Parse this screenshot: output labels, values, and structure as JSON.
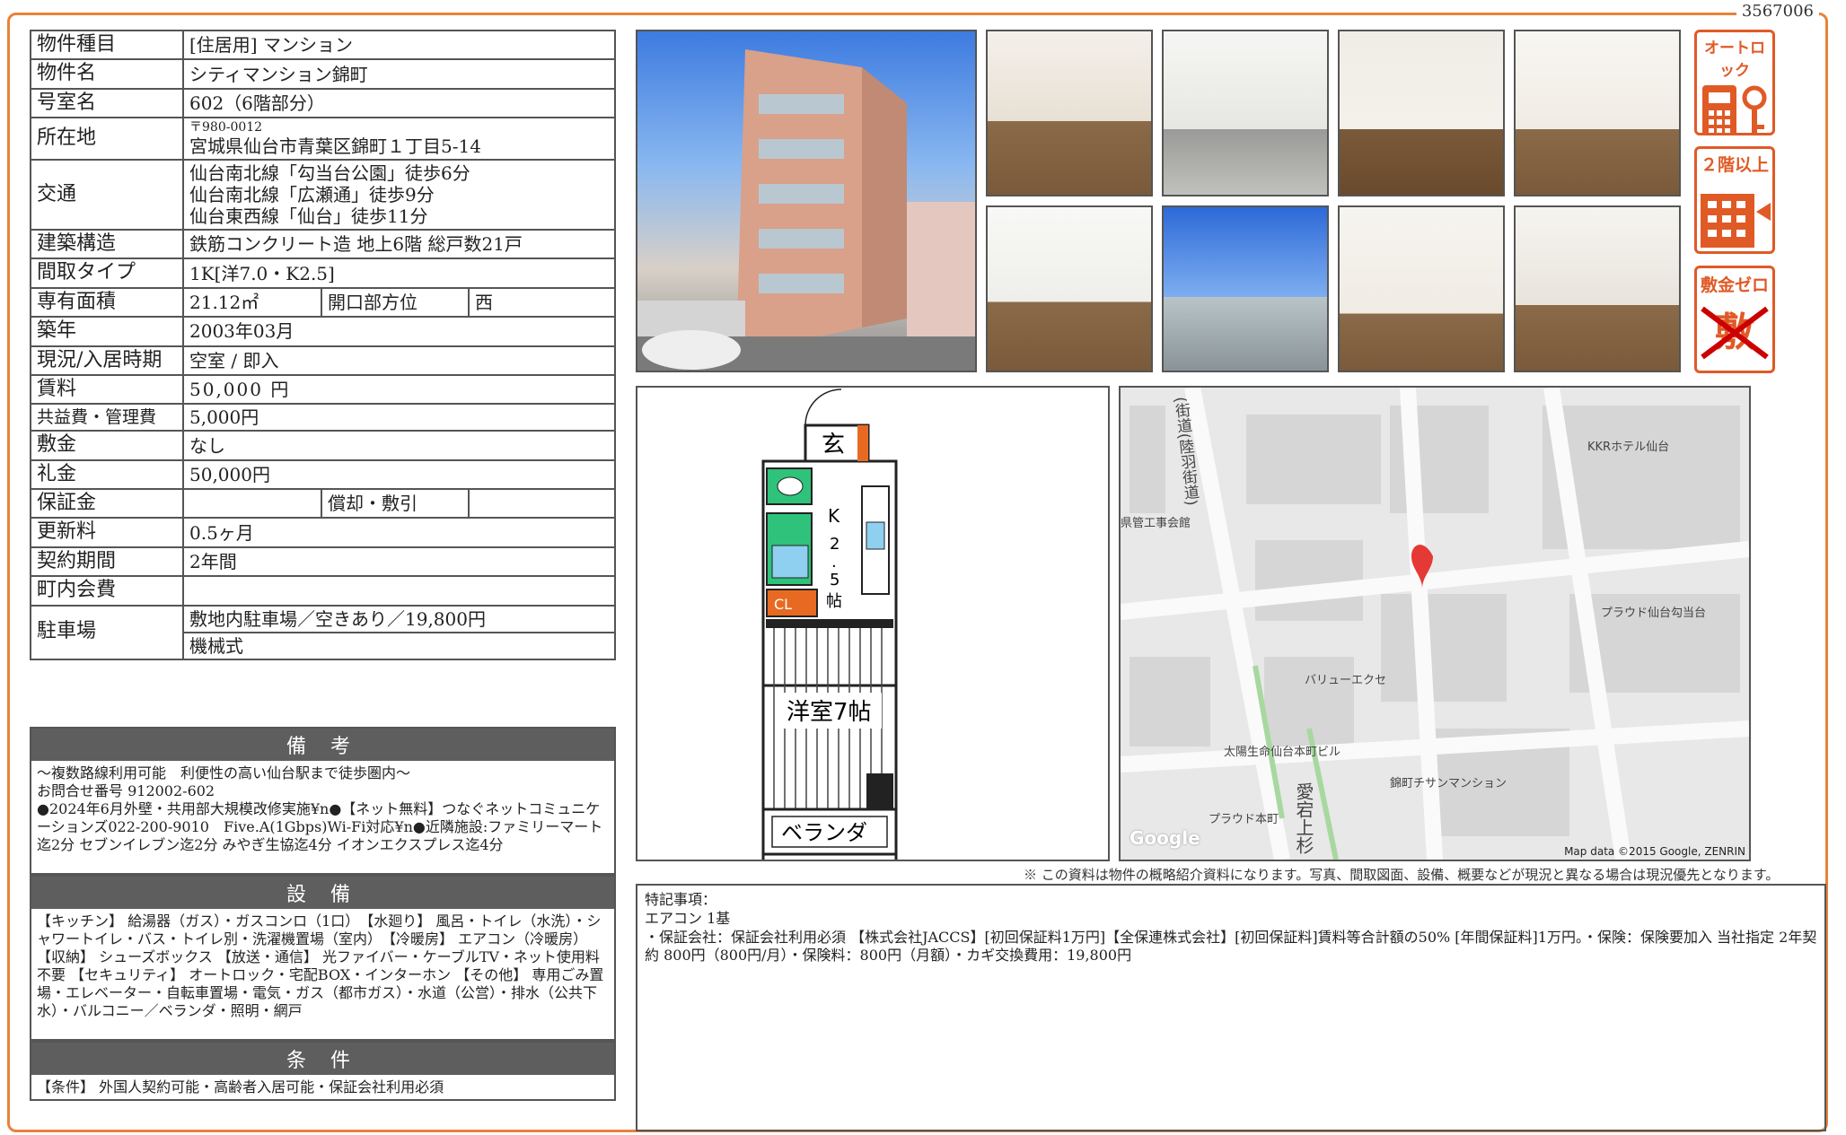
{
  "doc_id": "3567006",
  "spec": {
    "type_label": "物件種目",
    "type_value": "[住居用]  マンション",
    "name_label": "物件名",
    "name_value": "シティマンション錦町",
    "room_label": "号室名",
    "room_value": "602（6階部分）",
    "addr_label": "所在地",
    "addr_zip": "〒980-0012",
    "addr_value": "宮城県仙台市青葉区錦町１丁目5-14",
    "traffic_label": "交通",
    "traffic_1": "仙台南北線「勾当台公園」徒歩6分",
    "traffic_2": "仙台南北線「広瀬通」徒歩9分",
    "traffic_3": "仙台東西線「仙台」徒歩11分",
    "structure_label": "建築構造",
    "structure_value": "鉄筋コンクリート造  地上6階  総戸数21戸",
    "layout_label": "間取タイプ",
    "layout_value": "1K[洋7.0・K2.5]",
    "area_label": "専有面積",
    "area_value": "21.12㎡",
    "dir_label": "開口部方位",
    "dir_value": "西",
    "built_label": "築年",
    "built_value": "2003年03月",
    "status_label": "現況/入居時期",
    "status_value": "空室  /  即入",
    "rent_label": "賃料",
    "rent_value": "50,000 円",
    "fee_label": "共益費・管理費",
    "fee_value": "5,000円",
    "deposit_label": "敷金",
    "deposit_value": "なし",
    "key_label": "礼金",
    "key_value": "50,000円",
    "guar_label": "保証金",
    "guar_value": "",
    "amort_label": "償却・敷引",
    "amort_value": "",
    "renew_label": "更新料",
    "renew_value": "0.5ヶ月",
    "term_label": "契約期間",
    "term_value": "2年間",
    "town_label": "町内会費",
    "town_value": "",
    "parking_label": "駐車場",
    "parking_1": "敷地内駐車場／空きあり／19,800円",
    "parking_2": "機械式"
  },
  "remarks_head": "備 考",
  "remarks_text": "～複数路線利用可能　利便性の高い仙台駅まで徒歩圏内～\nお問合せ番号 912002-602\n●2024年6月外壁・共用部大規模改修実施¥n●【ネット無料】つなぐネットコミュニケーションズ022-200-9010　Five.A(1Gbps)Wi-Fi対応¥n●近隣施設:ファミリーマート迄2分 セブンイレブン迄2分 みやぎ生協迄4分 イオンエクスプレス迄4分",
  "equip_head": "設 備",
  "equip_text": "【キッチン】 給湯器（ガス）・ガスコンロ（1口）　【水廻り】 風呂・トイレ（水洗）・シャワートイレ・バス・トイレ別・洗濯機置場（室内）　【冷暖房】 エアコン（冷暖房）　【収納】 シューズボックス 【放送・通信】 光ファイバー・ケーブルTV・ネット使用料不要 【セキュリティ】 オートロック・宅配BOX・インターホン 【その他】 専用ごみ置場・エレベーター・自転車置場・電気・ガス（都市ガス）・水道（公営）・排水（公共下水）・バルコニー／ベランダ・照明・網戸",
  "cond_head": "条 件",
  "cond_text": "【条件】 外国人契約可能・高齢者入居可能・保証会社利用必須",
  "badges": {
    "autolock": "オートロック",
    "floor2": "２階以上",
    "zero": "敷金ゼロ",
    "zero_cross": "敷金"
  },
  "floorplan": {
    "entrance": "玄",
    "kitchen": "K\n2\n.\n5\n帖",
    "room": "洋室7帖",
    "veranda": "ベランダ",
    "mark": "CL"
  },
  "map": {
    "l1": "KKRホテル仙台",
    "l2": "プラウド仙台勾当台",
    "l3": "バリューエクセ",
    "l4": "太陽生命仙台本町ビル",
    "l5": "錦町チサンマンション",
    "l6": "プラウド本町",
    "l7": "県管工事会館",
    "l8": "(街道(陸羽街道)",
    "l9": "愛宕上杉",
    "credit": "Map data ©2015 Google, ZENRIN",
    "logo": "Google"
  },
  "note": "※ この資料は物件の概略紹介資料になります。写真、間取図面、設備、概要などが現況と異なる場合は現況優先となります。",
  "special_title": "特記事項：",
  "special_1": "エアコン 1基",
  "special_2": "・保証会社：保証会社利用必須 【株式会社JACCS】[初回保証料1万円]【全保連株式会社】[初回保証料]賃料等合計額の50% [年間保証料]1万円。・保険：保険要加入 当社指定 2年契約 800円（800円/月）・保険料：800円（月額）・カギ交換費用：19,800円"
}
